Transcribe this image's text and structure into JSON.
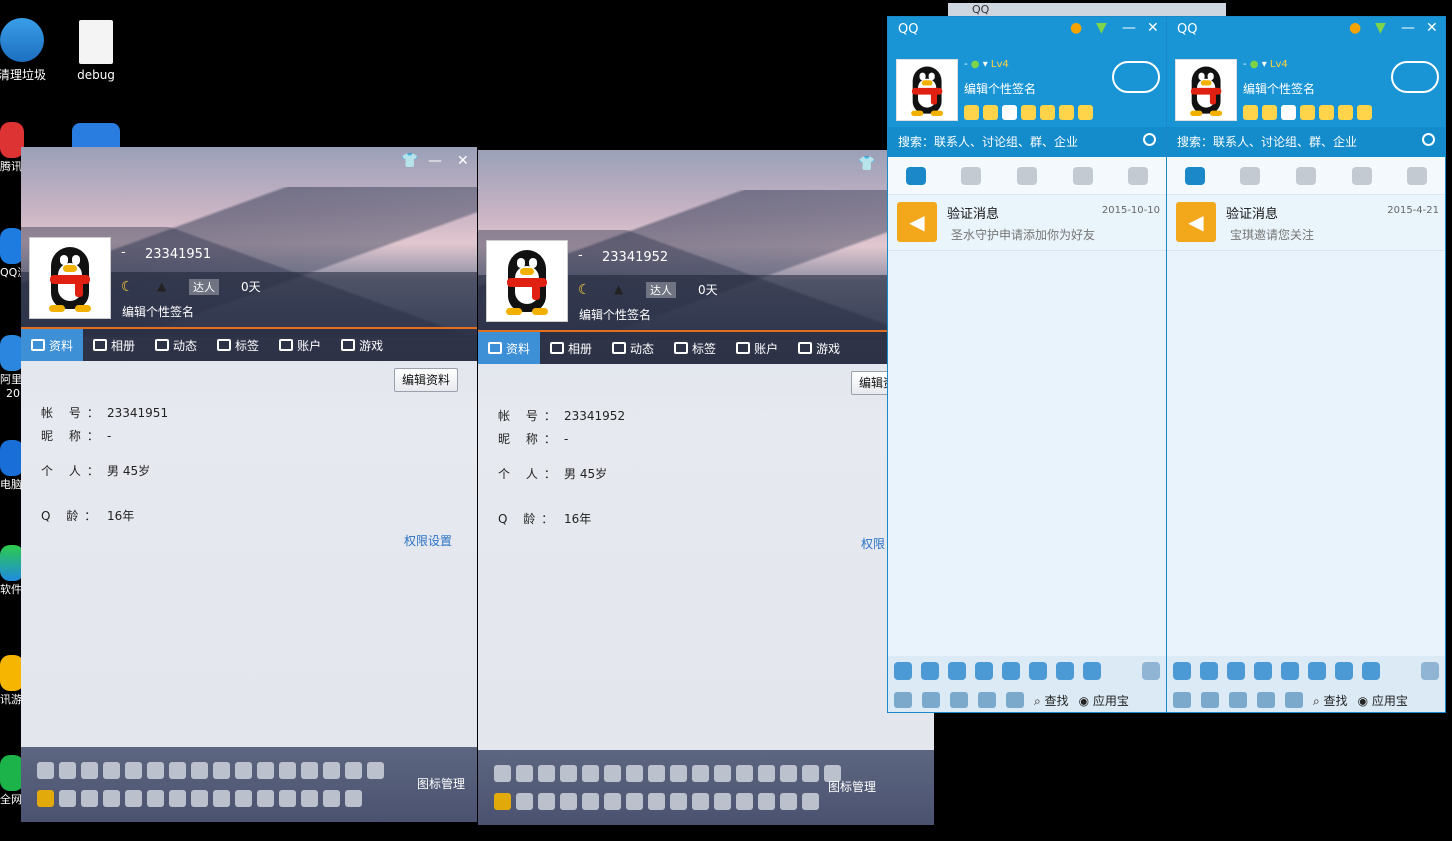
{
  "desktop": {
    "icons": [
      {
        "label": "清理垃圾",
        "icon": "broom-icon"
      },
      {
        "label": "debug",
        "icon": "file-icon"
      }
    ],
    "side_labels": [
      "腾讯",
      "QQ浏",
      "阿里",
      "20",
      "电脑",
      "软件",
      "讯游",
      "全网"
    ]
  },
  "profiles": [
    {
      "uin": "23341951",
      "name_dash": "-",
      "signature": "编辑个性签名",
      "level_badge": "达人",
      "days": "0天",
      "tabs": [
        "资料",
        "相册",
        "动态",
        "标签",
        "账户",
        "游戏"
      ],
      "edit_button": "编辑资料",
      "fields": [
        {
          "key": "帐 号：",
          "value": "23341951"
        },
        {
          "key": "昵 称：",
          "value": "-"
        },
        {
          "key": "个 人：",
          "value": "男  45岁"
        },
        {
          "key": "Q 龄：",
          "value": "16年"
        }
      ],
      "permission_link": "权限设置",
      "icon_manager": "图标管理"
    },
    {
      "uin": "23341952",
      "name_dash": "-",
      "signature": "编辑个性签名",
      "level_badge": "达人",
      "days": "0天",
      "tabs": [
        "资料",
        "相册",
        "动态",
        "标签",
        "账户",
        "游戏"
      ],
      "edit_button": "编辑资",
      "fields": [
        {
          "key": "帐 号：",
          "value": "23341952"
        },
        {
          "key": "昵 称：",
          "value": "-"
        },
        {
          "key": "个 人：",
          "value": "男  45岁"
        },
        {
          "key": "Q 龄：",
          "value": "16年"
        }
      ],
      "permission_link": "权限",
      "icon_manager": "图标管理"
    }
  ],
  "qq_panels": [
    {
      "title": "QQ",
      "name_dash": "-",
      "level": "Lv4",
      "signature": "编辑个性签名",
      "search_placeholder": "搜索：联系人、讨论组、群、企业",
      "message": {
        "title": "验证消息",
        "subtitle": "圣水守护申请添加你为好友",
        "date": "2015-10-10"
      },
      "find_label": "查找",
      "appstore_label": "应用宝"
    },
    {
      "title": "QQ",
      "name_dash": "-",
      "level": "Lv4",
      "signature": "编辑个性签名",
      "search_placeholder": "搜索：联系人、讨论组、群、企业",
      "message": {
        "title": "验证消息",
        "subtitle": "宝琪邀请您关注",
        "date": "2015-4-21"
      },
      "find_label": "查找",
      "appstore_label": "应用宝"
    }
  ],
  "behind_window_title": "QQ",
  "colors": {
    "qq_blue": "#1995d6",
    "tab_active": "#3d8fd6",
    "accent_orange": "#e07020",
    "link_blue": "#2a72c8"
  }
}
